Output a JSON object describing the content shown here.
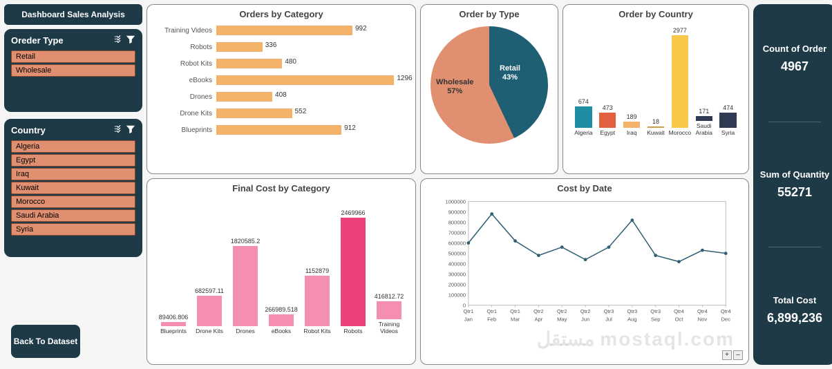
{
  "title": "Dashboard Sales Analysis",
  "back_button": "Back To Dataset",
  "slicers": {
    "order_type": {
      "title": "Oreder Type",
      "items": [
        "Retail",
        "Wholesale"
      ]
    },
    "country": {
      "title": "Country",
      "items": [
        "Algeria",
        "Egypt",
        "Iraq",
        "Kuwait",
        "Morocco",
        "Saudi Arabia",
        "Syria"
      ]
    }
  },
  "kpis": [
    {
      "label": "Count of Order",
      "value": "4967"
    },
    {
      "label": "Sum of Quantity",
      "value": "55271"
    },
    {
      "label": "Total Cost",
      "value": "6,899,236"
    }
  ],
  "colors": {
    "dark": "#1e3a47",
    "teal": "#1e8fa3",
    "salmon": "#e09070",
    "amber": "#f4b36a",
    "pink": "#f48fb1",
    "pink_dark": "#ec407a",
    "navy": "#2f3b52"
  },
  "watermark": "مستقل mostaql.com",
  "chart_data": [
    {
      "id": "orders_by_category",
      "type": "bar",
      "orientation": "horizontal",
      "title": "Orders by Category",
      "categories": [
        "Training Videos",
        "Robots",
        "Robot Kits",
        "eBooks",
        "Drones",
        "Drone Kits",
        "Blueprints"
      ],
      "values": [
        992,
        336,
        480,
        1296,
        408,
        552,
        912
      ],
      "xlim": [
        0,
        1400
      ],
      "bar_color": "#f4b36a"
    },
    {
      "id": "order_by_type",
      "type": "pie",
      "title": "Order by Type",
      "slices": [
        {
          "name": "Retail",
          "pct": 43,
          "color": "#1e5f73"
        },
        {
          "name": "Wholesale",
          "pct": 57,
          "color": "#e09070"
        }
      ]
    },
    {
      "id": "order_by_country",
      "type": "bar",
      "title": "Order by Country",
      "categories": [
        "Algeria",
        "Egypt",
        "Iraq",
        "Kuwait",
        "Morocco",
        "Saudi Arabia",
        "Syria"
      ],
      "values": [
        674,
        473,
        189,
        18,
        2977,
        171,
        474
      ],
      "colors": [
        "#1e8fa3",
        "#e06040",
        "#f4b36a",
        "#c9a050",
        "#f7c948",
        "#2f3b52",
        "#2f3b52"
      ],
      "ylim": [
        0,
        3000
      ]
    },
    {
      "id": "final_cost_by_category",
      "type": "bar",
      "title": "Final Cost by Category",
      "categories": [
        "Blueprints",
        "Drone Kits",
        "Drones",
        "eBooks",
        "Robot Kits",
        "Robots",
        "Training Videos"
      ],
      "values": [
        89406.806,
        682597.11,
        1820585.2,
        266989.518,
        1152879,
        2469966,
        416812.72
      ],
      "ylim": [
        0,
        2600000
      ],
      "bar_color": "#f48fb1",
      "highlight_index": 5,
      "highlight_color": "#ec407a"
    },
    {
      "id": "cost_by_date",
      "type": "line",
      "title": "Cost by Date",
      "x_top": [
        "Qtr1",
        "Qtr1",
        "Qtr1",
        "Qtr2",
        "Qtr2",
        "Qtr2",
        "Qtr3",
        "Qtr3",
        "Qtr3",
        "Qtr4",
        "Qtr4",
        "Qtr4"
      ],
      "x_bottom": [
        "Jan",
        "Feb",
        "Mar",
        "Apr",
        "May",
        "Jun",
        "Jul",
        "Aug",
        "Sep",
        "Oct",
        "Nov",
        "Dec"
      ],
      "y_ticks": [
        0,
        100000,
        200000,
        300000,
        400000,
        500000,
        600000,
        700000,
        800000,
        900000,
        1000000
      ],
      "values": [
        600000,
        880000,
        620000,
        480000,
        560000,
        440000,
        560000,
        820000,
        480000,
        420000,
        530000,
        500000
      ],
      "ylim": [
        0,
        1000000
      ],
      "line_color": "#2f5f73"
    }
  ]
}
